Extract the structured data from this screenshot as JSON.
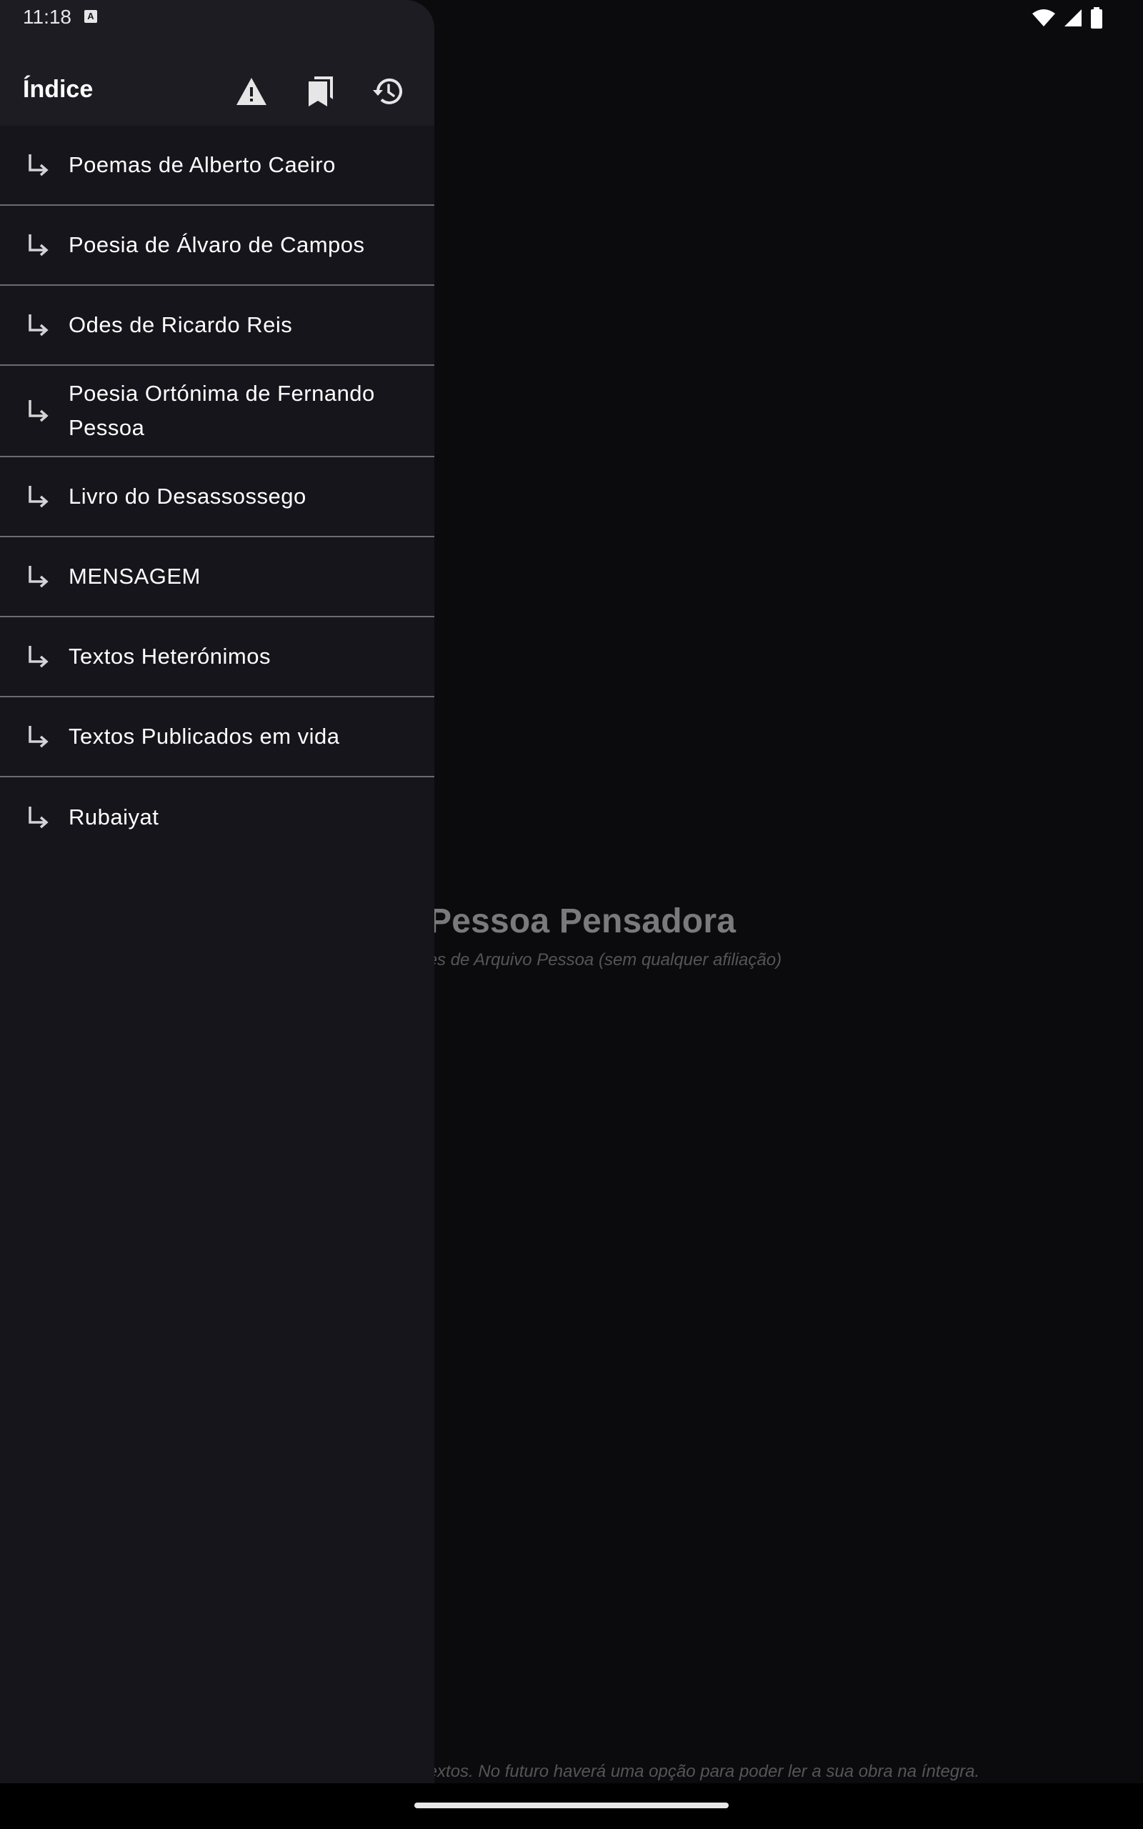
{
  "status_bar": {
    "time": "11:18",
    "notification_badge": "A",
    "icons": [
      "wifi-icon",
      "signal-icon",
      "battery-icon"
    ]
  },
  "background_page": {
    "title": "Pessoa Pensadora",
    "subtitle": "ientes de Arquivo Pessoa (sem qualquer afiliação)",
    "footer": "os textos. No futuro haverá uma opção para poder ler a sua obra na íntegra."
  },
  "drawer": {
    "title": "Índice",
    "header_icons": [
      "warning-icon",
      "bookmarks-icon",
      "history-icon"
    ],
    "items": [
      {
        "label": "Poemas de Alberto Caeiro"
      },
      {
        "label": "Poesia de Álvaro de Campos"
      },
      {
        "label": "Odes de Ricardo Reis"
      },
      {
        "label": "Poesia Ortónima de Fernando Pessoa"
      },
      {
        "label": "Livro do Desassossego"
      },
      {
        "label": "MENSAGEM"
      },
      {
        "label": "Textos Heterónimos"
      },
      {
        "label": "Textos Publicados em vida"
      },
      {
        "label": "Rubaiyat"
      }
    ]
  },
  "colors": {
    "drawer_bg": "#16151b",
    "drawer_header_bg": "#1d1c22",
    "divider": "#6c6b71",
    "screen_bg": "#0b0b0e",
    "text": "#ffffff"
  }
}
